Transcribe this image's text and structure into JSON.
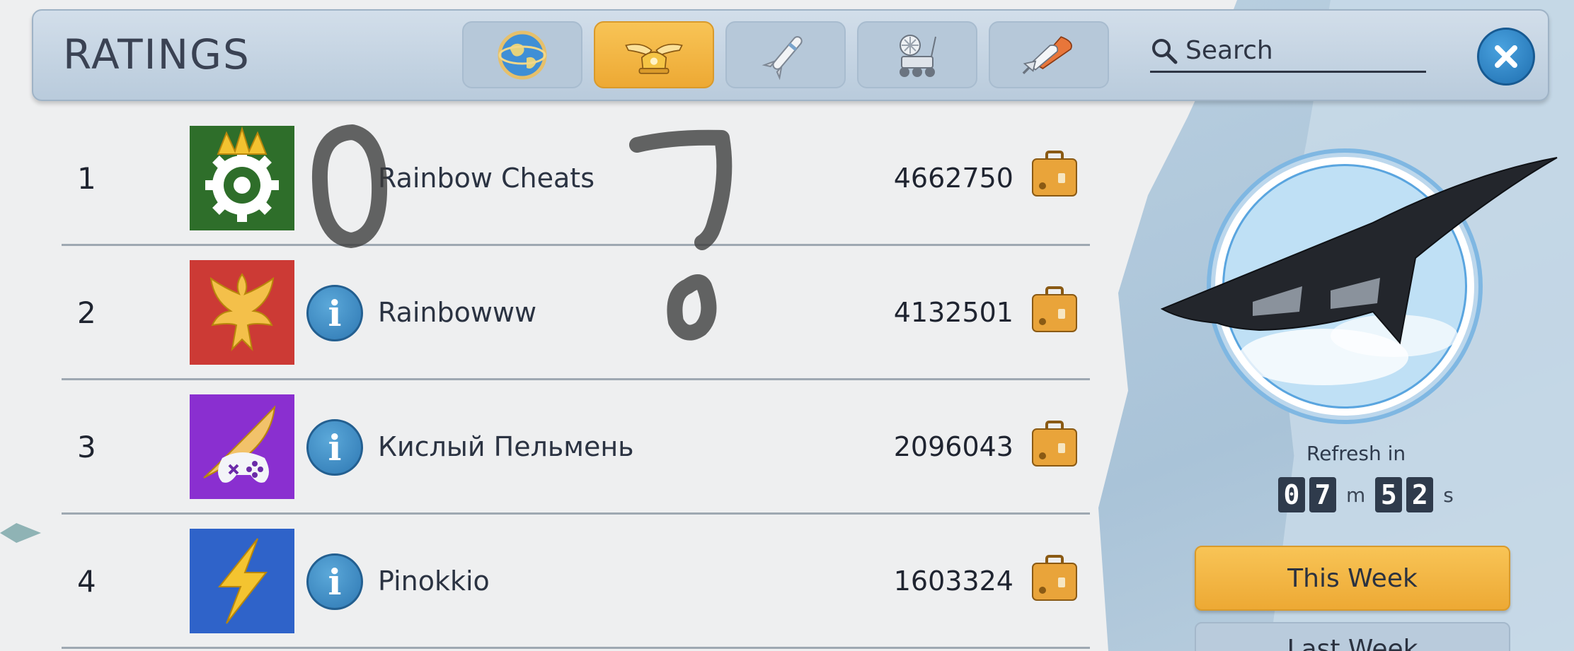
{
  "header": {
    "title": "RATINGS",
    "tabs": [
      {
        "icon": "globe-icon",
        "active": false
      },
      {
        "icon": "winged-helmet-icon",
        "active": true
      },
      {
        "icon": "rocket-icon",
        "active": false
      },
      {
        "icon": "rover-icon",
        "active": false
      },
      {
        "icon": "space-shuttle-icon",
        "active": false
      }
    ],
    "search": {
      "placeholder": "Search",
      "value": ""
    },
    "close_icon": "close-icon"
  },
  "rows": [
    {
      "rank": "1",
      "name": "Rainbow Cheats",
      "score": "4662750",
      "avatar": "gear-crown-avatar",
      "avatar_color": "#2e6e2a"
    },
    {
      "rank": "2",
      "name": "Rainbowww",
      "score": "4132501",
      "avatar": "phoenix-avatar",
      "avatar_color": "#cc3a35"
    },
    {
      "rank": "3",
      "name": "Кислый Пельмень",
      "score": "2096043",
      "avatar": "winged-gamepad-avatar",
      "avatar_color": "#8a2fd0"
    },
    {
      "rank": "4",
      "name": "Pinokkio",
      "score": "1603324",
      "avatar": "lightning-avatar",
      "avatar_color": "#2f63c9"
    }
  ],
  "sidebar": {
    "refresh_label": "Refresh in",
    "timer": {
      "minutes": [
        "0",
        "7"
      ],
      "minutes_unit": "m",
      "seconds": [
        "5",
        "2"
      ],
      "seconds_unit": "s"
    },
    "this_week_label": "This Week",
    "last_week_label": "Last Week"
  },
  "colors": {
    "accent": "#f2b23f",
    "info_blue": "#2e78b3",
    "header": "#c4d4e3"
  }
}
